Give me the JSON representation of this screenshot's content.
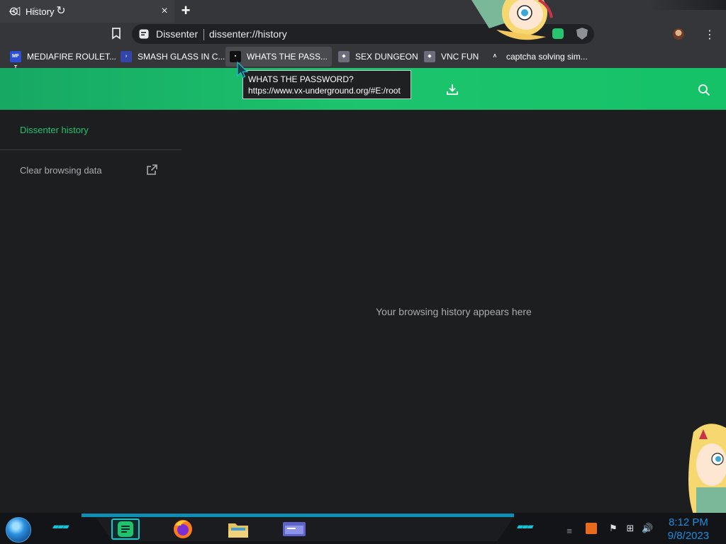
{
  "tab": {
    "title": "History",
    "close": "×",
    "new_tab": "+"
  },
  "toolbar": {
    "back": "◁",
    "forward": "▷",
    "reload": "↻",
    "bookmark": "⊔",
    "omnibox": {
      "site_name": "Dissenter",
      "url": "dissenter://history"
    },
    "menu": "⋮"
  },
  "bookmarks": [
    {
      "label": "MEDIAFIRE ROULET...",
      "icon_text": "MF T",
      "icon_color": "#2b4fd6"
    },
    {
      "label": "SMASH GLASS IN C...",
      "icon_text": "›",
      "icon_color": "#3445a8"
    },
    {
      "label": "WHATS THE PASS...",
      "icon_text": "▪",
      "icon_color": "#101010"
    },
    {
      "label": "SEX DUNGEON",
      "icon_text": "◆",
      "icon_color": "#6c6c7a"
    },
    {
      "label": "VNC FUN",
      "icon_text": "◆",
      "icon_color": "#6c6c7a"
    },
    {
      "label": "captcha solving sim...",
      "icon_text": "Λ",
      "icon_color": "#35363a"
    }
  ],
  "tooltip": {
    "title": "WHATS THE PASSWORD?",
    "url": "https://www.vx-underground.org/#E:/root"
  },
  "sidebar": {
    "title": "Dissenter history",
    "clear": "Clear browsing data"
  },
  "main": {
    "empty_message": "Your browsing history appears here"
  },
  "taskbar": {
    "time": "8:12 PM",
    "date": "9/8/2023"
  },
  "colors": {
    "accent_green": "#1ec46b",
    "header_green": "#1cc46d",
    "taskbar_cyan": "#18c3d8"
  }
}
